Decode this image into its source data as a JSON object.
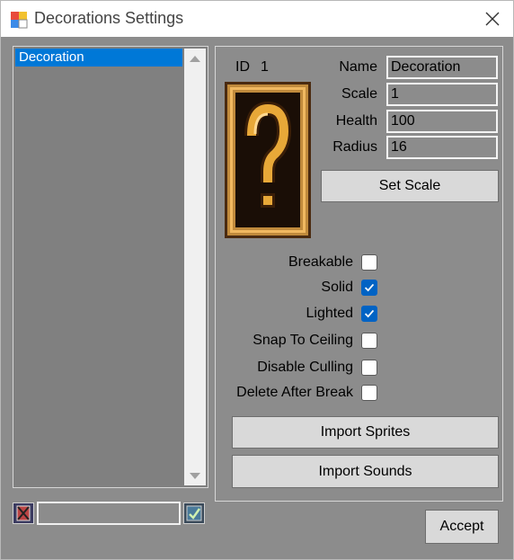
{
  "window": {
    "title": "Decorations Settings"
  },
  "list": {
    "items": [
      "Decoration"
    ]
  },
  "properties": {
    "id_label": "ID",
    "id_value": "1",
    "name_label": "Name",
    "name_value": "Decoration",
    "scale_label": "Scale",
    "scale_value": "1",
    "health_label": "Health",
    "health_value": "100",
    "radius_label": "Radius",
    "radius_value": "16",
    "set_scale_label": "Set Scale"
  },
  "checkboxes": [
    {
      "label": "Breakable",
      "checked": false
    },
    {
      "label": "Solid",
      "checked": true
    },
    {
      "label": "Lighted",
      "checked": true
    },
    {
      "label": "Snap To Ceiling",
      "checked": false
    },
    {
      "label": "Disable Culling",
      "checked": false
    },
    {
      "label": "Delete After Break",
      "checked": false
    }
  ],
  "buttons": {
    "import_sprites": "Import Sprites",
    "import_sounds": "Import Sounds",
    "accept": "Accept"
  },
  "colors": {
    "dialog_bg": "#8c8c8c",
    "selection": "#0078d7",
    "checkbox_checked": "#0063c4",
    "sprite_frame": "#c08a3c"
  }
}
